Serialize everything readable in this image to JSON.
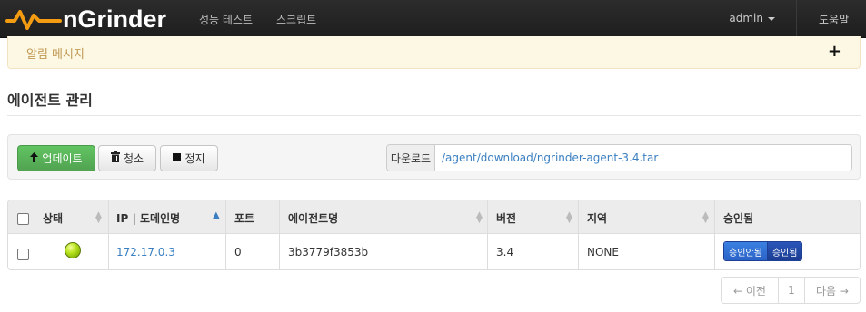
{
  "app": {
    "brand": "nGrinder",
    "nav": [
      {
        "label": "성능 테스트"
      },
      {
        "label": "스크립트"
      }
    ],
    "user": "admin",
    "help": "도움말"
  },
  "alert": {
    "text": "알림 메시지",
    "toggle": "+"
  },
  "page": {
    "title": "에이전트 관리"
  },
  "toolbar": {
    "update_label": "업데이트",
    "clean_label": "청소",
    "stop_label": "정지",
    "download_label": "다운로드",
    "download_link": "/agent/download/ngrinder-agent-3.4.tar"
  },
  "table": {
    "columns": [
      "상태",
      "IP | 도메인명",
      "포트",
      "에이전트명",
      "버전",
      "지역",
      "승인됨"
    ],
    "rows": [
      {
        "status": "ready",
        "ip": "172.17.0.3",
        "port": "0",
        "name": "3b3779f3853b",
        "version": "3.4",
        "region": "NONE",
        "approve_off": "승인안됨",
        "approve_on": "승인됨"
      }
    ]
  },
  "pagination": {
    "prev": "← 이전",
    "current": "1",
    "next": "다음 →"
  },
  "colors": {
    "navbar": "#1e1e1e",
    "alert_bg": "#fcf8e3",
    "success": "#51a351",
    "link": "#3a7fc1",
    "approve": "#2b63c8"
  }
}
